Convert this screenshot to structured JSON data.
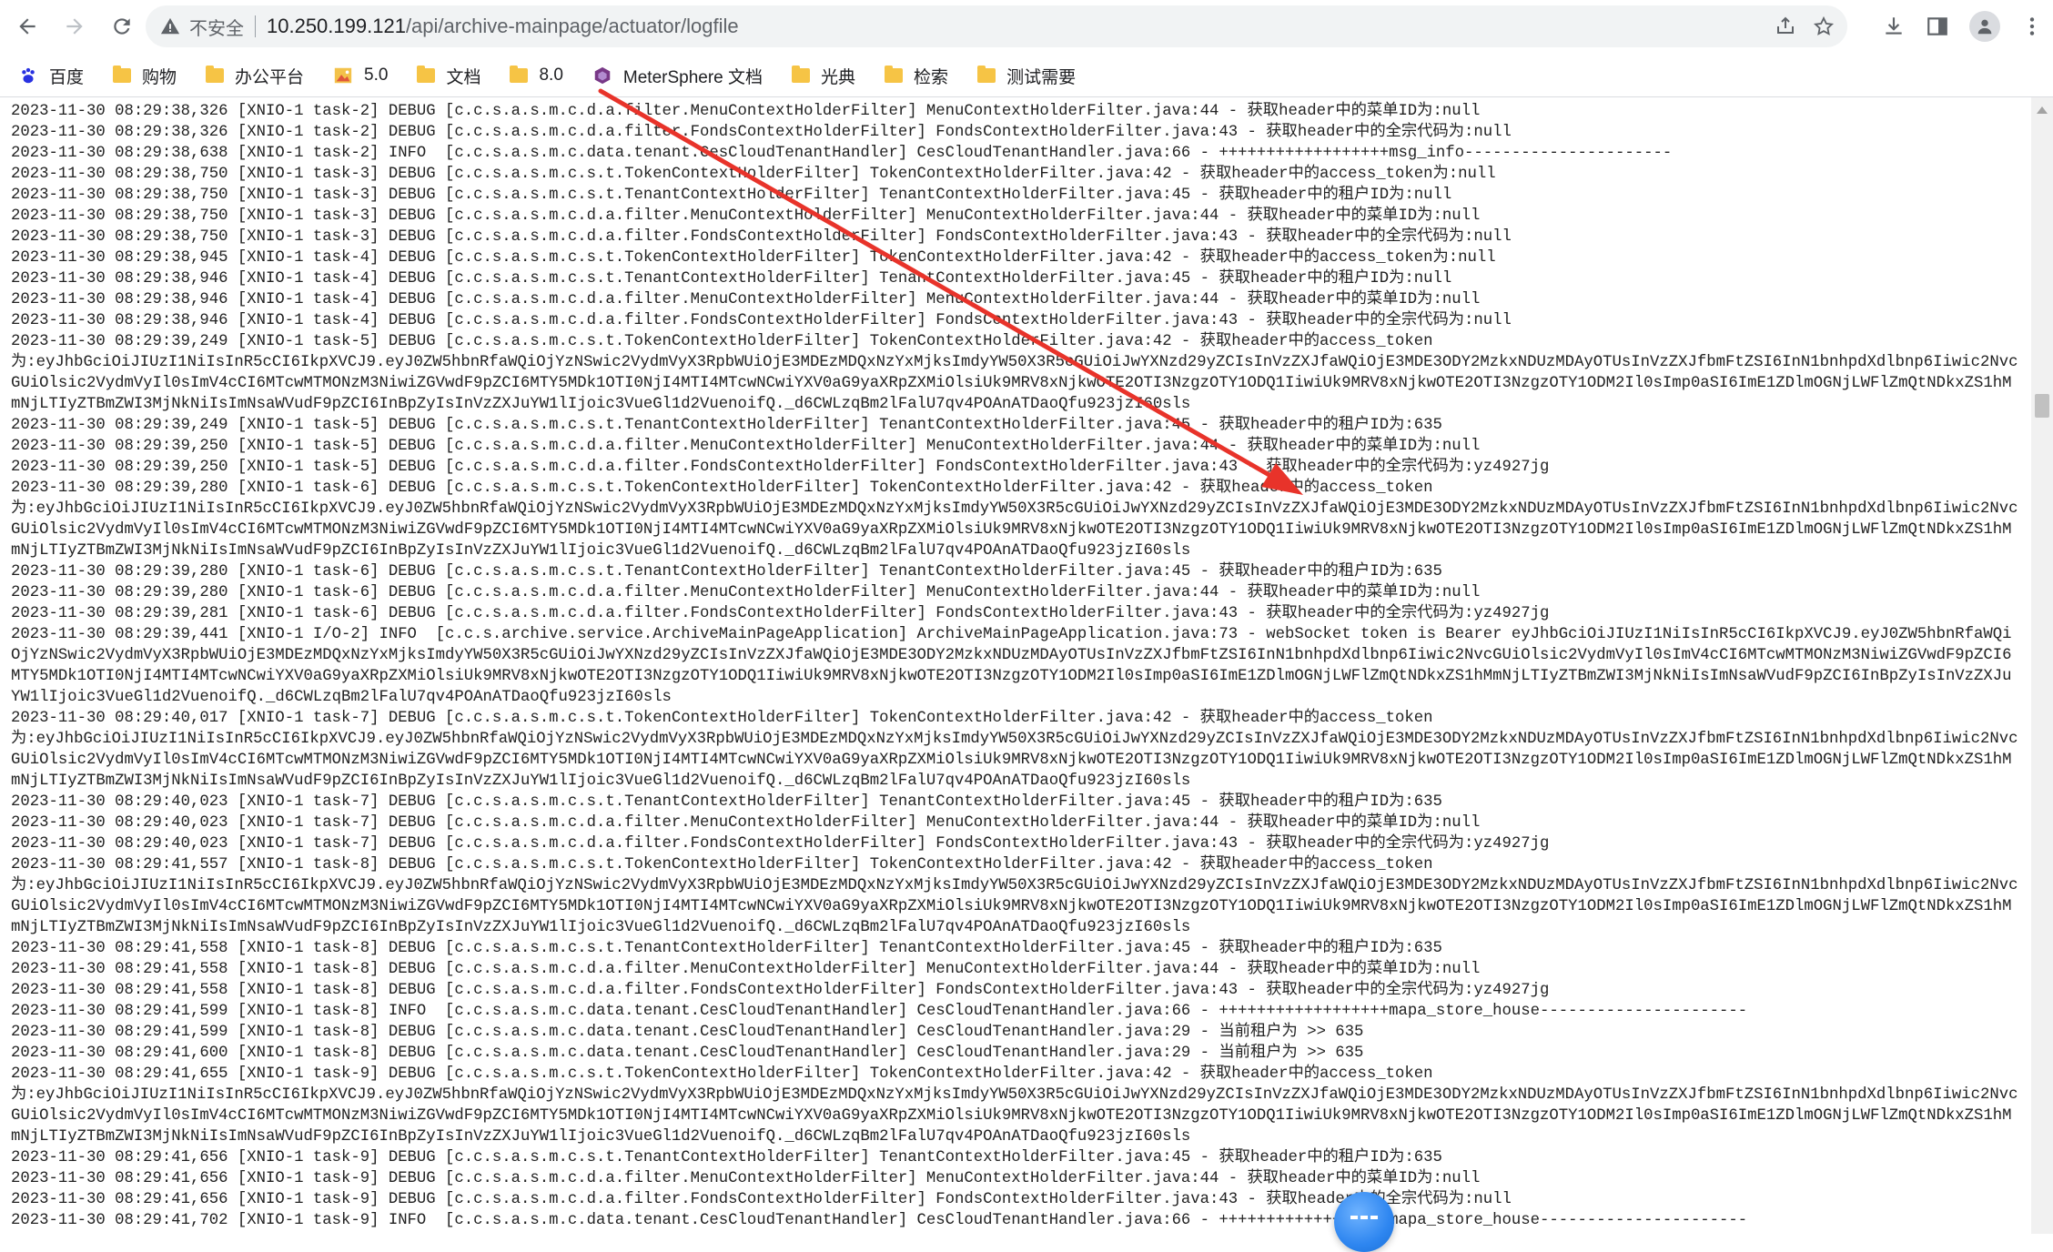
{
  "browser": {
    "insecure_label": "不安全",
    "url_host": "10.250.199.121",
    "url_path": "/api/archive-mainpage/actuator/logfile"
  },
  "bookmarks": [
    {
      "label": "百度",
      "icon": "baidu-paw-icon"
    },
    {
      "label": "购物",
      "icon": "folder-icon"
    },
    {
      "label": "办公平台",
      "icon": "folder-icon"
    },
    {
      "label": "5.0",
      "icon": "image-bookmark-icon"
    },
    {
      "label": "文档",
      "icon": "folder-icon"
    },
    {
      "label": "8.0",
      "icon": "folder-icon"
    },
    {
      "label": "MeterSphere 文档",
      "icon": "metersphere-icon"
    },
    {
      "label": "光典",
      "icon": "folder-icon"
    },
    {
      "label": "检索",
      "icon": "folder-icon"
    },
    {
      "label": "测试需要",
      "icon": "folder-icon"
    }
  ],
  "colors": {
    "arrow": "#e8332a",
    "folder": "#f6c445",
    "float_ball": "#2e86f0"
  },
  "log_lines": [
    "2023-11-30 08:29:38,326 [XNIO-1 task-2] DEBUG [c.c.s.a.s.m.c.d.a.filter.MenuContextHolderFilter] MenuContextHolderFilter.java:44 - 获取header中的菜单ID为:null",
    "2023-11-30 08:29:38,326 [XNIO-1 task-2] DEBUG [c.c.s.a.s.m.c.d.a.filter.FondsContextHolderFilter] FondsContextHolderFilter.java:43 - 获取header中的全宗代码为:null",
    "2023-11-30 08:29:38,638 [XNIO-1 task-2] INFO  [c.c.s.a.s.m.c.data.tenant.CesCloudTenantHandler] CesCloudTenantHandler.java:66 - ++++++++++++++++++msg_info----------------------",
    "2023-11-30 08:29:38,750 [XNIO-1 task-3] DEBUG [c.c.s.a.s.m.c.s.t.TokenContextHolderFilter] TokenContextHolderFilter.java:42 - 获取header中的access_token为:null",
    "2023-11-30 08:29:38,750 [XNIO-1 task-3] DEBUG [c.c.s.a.s.m.c.s.t.TenantContextHolderFilter] TenantContextHolderFilter.java:45 - 获取header中的租户ID为:null",
    "2023-11-30 08:29:38,750 [XNIO-1 task-3] DEBUG [c.c.s.a.s.m.c.d.a.filter.MenuContextHolderFilter] MenuContextHolderFilter.java:44 - 获取header中的菜单ID为:null",
    "2023-11-30 08:29:38,750 [XNIO-1 task-3] DEBUG [c.c.s.a.s.m.c.d.a.filter.FondsContextHolderFilter] FondsContextHolderFilter.java:43 - 获取header中的全宗代码为:null",
    "2023-11-30 08:29:38,945 [XNIO-1 task-4] DEBUG [c.c.s.a.s.m.c.s.t.TokenContextHolderFilter] TokenContextHolderFilter.java:42 - 获取header中的access_token为:null",
    "2023-11-30 08:29:38,946 [XNIO-1 task-4] DEBUG [c.c.s.a.s.m.c.s.t.TenantContextHolderFilter] TenantContextHolderFilter.java:45 - 获取header中的租户ID为:null",
    "2023-11-30 08:29:38,946 [XNIO-1 task-4] DEBUG [c.c.s.a.s.m.c.d.a.filter.MenuContextHolderFilter] MenuContextHolderFilter.java:44 - 获取header中的菜单ID为:null",
    "2023-11-30 08:29:38,946 [XNIO-1 task-4] DEBUG [c.c.s.a.s.m.c.d.a.filter.FondsContextHolderFilter] FondsContextHolderFilter.java:43 - 获取header中的全宗代码为:null",
    "2023-11-30 08:29:39,249 [XNIO-1 task-5] DEBUG [c.c.s.a.s.m.c.s.t.TokenContextHolderFilter] TokenContextHolderFilter.java:42 - 获取header中的access_token",
    "为:eyJhbGciOiJIUzI1NiIsInR5cCI6IkpXVCJ9.eyJ0ZW5hbnRfaWQiOjYzNSwic2VydmVyX3RpbWUiOjE3MDEzMDQxNzYxMjksImdyYW50X3R5cGUiOiJwYXNzd29yZCIsInVzZXJfaWQiOjE3MDE3ODY2MzkxNDUzMDAyOTUsInVzZXJfbmFtZSI6InN1bnhpdXdlbnp6Iiwic2NvcGUiOlsic2VydmVyIl0sImV4cCI6MTcwMTMONzM3NiwiZGVwdF9pZCI6MTY5MDk1OTI0NjI4MTI4MTcwNCwiYXV0aG9yaXRpZXMiOlsiUk9MRV8xNjkwOTE2OTI3NzgzOTY1ODQ1IiwiUk9MRV8xNjkwOTE2OTI3NzgzOTY1ODM2Il0sImp0aSI6ImE1ZDlmOGNjLWFlZmQtNDkxZS1hMmNjLTIyZTBmZWI3MjNkNiIsImNsaWVudF9pZCI6InBpZyIsInVzZXJuYW1lIjoic3VueGl1d2VuenoifQ._d6CWLzqBm2lFalU7qv4POAnATDaoQfu923jzI60sls",
    "2023-11-30 08:29:39,249 [XNIO-1 task-5] DEBUG [c.c.s.a.s.m.c.s.t.TenantContextHolderFilter] TenantContextHolderFilter.java:45 - 获取header中的租户ID为:635",
    "2023-11-30 08:29:39,250 [XNIO-1 task-5] DEBUG [c.c.s.a.s.m.c.d.a.filter.MenuContextHolderFilter] MenuContextHolderFilter.java:44 - 获取header中的菜单ID为:null",
    "2023-11-30 08:29:39,250 [XNIO-1 task-5] DEBUG [c.c.s.a.s.m.c.d.a.filter.FondsContextHolderFilter] FondsContextHolderFilter.java:43 - 获取header中的全宗代码为:yz4927jg",
    "2023-11-30 08:29:39,280 [XNIO-1 task-6] DEBUG [c.c.s.a.s.m.c.s.t.TokenContextHolderFilter] TokenContextHolderFilter.java:42 - 获取header中的access_token",
    "为:eyJhbGciOiJIUzI1NiIsInR5cCI6IkpXVCJ9.eyJ0ZW5hbnRfaWQiOjYzNSwic2VydmVyX3RpbWUiOjE3MDEzMDQxNzYxMjksImdyYW50X3R5cGUiOiJwYXNzd29yZCIsInVzZXJfaWQiOjE3MDE3ODY2MzkxNDUzMDAyOTUsInVzZXJfbmFtZSI6InN1bnhpdXdlbnp6Iiwic2NvcGUiOlsic2VydmVyIl0sImV4cCI6MTcwMTMONzM3NiwiZGVwdF9pZCI6MTY5MDk1OTI0NjI4MTI4MTcwNCwiYXV0aG9yaXRpZXMiOlsiUk9MRV8xNjkwOTE2OTI3NzgzOTY1ODQ1IiwiUk9MRV8xNjkwOTE2OTI3NzgzOTY1ODM2Il0sImp0aSI6ImE1ZDlmOGNjLWFlZmQtNDkxZS1hMmNjLTIyZTBmZWI3MjNkNiIsImNsaWVudF9pZCI6InBpZyIsInVzZXJuYW1lIjoic3VueGl1d2VuenoifQ._d6CWLzqBm2lFalU7qv4POAnATDaoQfu923jzI60sls",
    "2023-11-30 08:29:39,280 [XNIO-1 task-6] DEBUG [c.c.s.a.s.m.c.s.t.TenantContextHolderFilter] TenantContextHolderFilter.java:45 - 获取header中的租户ID为:635",
    "2023-11-30 08:29:39,280 [XNIO-1 task-6] DEBUG [c.c.s.a.s.m.c.d.a.filter.MenuContextHolderFilter] MenuContextHolderFilter.java:44 - 获取header中的菜单ID为:null",
    "2023-11-30 08:29:39,281 [XNIO-1 task-6] DEBUG [c.c.s.a.s.m.c.d.a.filter.FondsContextHolderFilter] FondsContextHolderFilter.java:43 - 获取header中的全宗代码为:yz4927jg",
    "2023-11-30 08:29:39,441 [XNIO-1 I/O-2] INFO  [c.c.s.archive.service.ArchiveMainPageApplication] ArchiveMainPageApplication.java:73 - webSocket token is Bearer eyJhbGciOiJIUzI1NiIsInR5cCI6IkpXVCJ9.eyJ0ZW5hbnRfaWQiOjYzNSwic2VydmVyX3RpbWUiOjE3MDEzMDQxNzYxMjksImdyYW50X3R5cGUiOiJwYXNzd29yZCIsInVzZXJfaWQiOjE3MDE3ODY2MzkxNDUzMDAyOTUsInVzZXJfbmFtZSI6InN1bnhpdXdlbnp6Iiwic2NvcGUiOlsic2VydmVyIl0sImV4cCI6MTcwMTMONzM3NiwiZGVwdF9pZCI6MTY5MDk1OTI0NjI4MTI4MTcwNCwiYXV0aG9yaXRpZXMiOlsiUk9MRV8xNjkwOTE2OTI3NzgzOTY1ODQ1IiwiUk9MRV8xNjkwOTE2OTI3NzgzOTY1ODM2Il0sImp0aSI6ImE1ZDlmOGNjLWFlZmQtNDkxZS1hMmNjLTIyZTBmZWI3MjNkNiIsImNsaWVudF9pZCI6InBpZyIsInVzZXJuYW1lIjoic3VueGl1d2VuenoifQ._d6CWLzqBm2lFalU7qv4POAnATDaoQfu923jzI60sls",
    "2023-11-30 08:29:40,017 [XNIO-1 task-7] DEBUG [c.c.s.a.s.m.c.s.t.TokenContextHolderFilter] TokenContextHolderFilter.java:42 - 获取header中的access_token",
    "为:eyJhbGciOiJIUzI1NiIsInR5cCI6IkpXVCJ9.eyJ0ZW5hbnRfaWQiOjYzNSwic2VydmVyX3RpbWUiOjE3MDEzMDQxNzYxMjksImdyYW50X3R5cGUiOiJwYXNzd29yZCIsInVzZXJfaWQiOjE3MDE3ODY2MzkxNDUzMDAyOTUsInVzZXJfbmFtZSI6InN1bnhpdXdlbnp6Iiwic2NvcGUiOlsic2VydmVyIl0sImV4cCI6MTcwMTMONzM3NiwiZGVwdF9pZCI6MTY5MDk1OTI0NjI4MTI4MTcwNCwiYXV0aG9yaXRpZXMiOlsiUk9MRV8xNjkwOTE2OTI3NzgzOTY1ODQ1IiwiUk9MRV8xNjkwOTE2OTI3NzgzOTY1ODM2Il0sImp0aSI6ImE1ZDlmOGNjLWFlZmQtNDkxZS1hMmNjLTIyZTBmZWI3MjNkNiIsImNsaWVudF9pZCI6InBpZyIsInVzZXJuYW1lIjoic3VueGl1d2VuenoifQ._d6CWLzqBm2lFalU7qv4POAnATDaoQfu923jzI60sls",
    "2023-11-30 08:29:40,023 [XNIO-1 task-7] DEBUG [c.c.s.a.s.m.c.s.t.TenantContextHolderFilter] TenantContextHolderFilter.java:45 - 获取header中的租户ID为:635",
    "2023-11-30 08:29:40,023 [XNIO-1 task-7] DEBUG [c.c.s.a.s.m.c.d.a.filter.MenuContextHolderFilter] MenuContextHolderFilter.java:44 - 获取header中的菜单ID为:null",
    "2023-11-30 08:29:40,023 [XNIO-1 task-7] DEBUG [c.c.s.a.s.m.c.d.a.filter.FondsContextHolderFilter] FondsContextHolderFilter.java:43 - 获取header中的全宗代码为:yz4927jg",
    "2023-11-30 08:29:41,557 [XNIO-1 task-8] DEBUG [c.c.s.a.s.m.c.s.t.TokenContextHolderFilter] TokenContextHolderFilter.java:42 - 获取header中的access_token",
    "为:eyJhbGciOiJIUzI1NiIsInR5cCI6IkpXVCJ9.eyJ0ZW5hbnRfaWQiOjYzNSwic2VydmVyX3RpbWUiOjE3MDEzMDQxNzYxMjksImdyYW50X3R5cGUiOiJwYXNzd29yZCIsInVzZXJfaWQiOjE3MDE3ODY2MzkxNDUzMDAyOTUsInVzZXJfbmFtZSI6InN1bnhpdXdlbnp6Iiwic2NvcGUiOlsic2VydmVyIl0sImV4cCI6MTcwMTMONzM3NiwiZGVwdF9pZCI6MTY5MDk1OTI0NjI4MTI4MTcwNCwiYXV0aG9yaXRpZXMiOlsiUk9MRV8xNjkwOTE2OTI3NzgzOTY1ODQ1IiwiUk9MRV8xNjkwOTE2OTI3NzgzOTY1ODM2Il0sImp0aSI6ImE1ZDlmOGNjLWFlZmQtNDkxZS1hMmNjLTIyZTBmZWI3MjNkNiIsImNsaWVudF9pZCI6InBpZyIsInVzZXJuYW1lIjoic3VueGl1d2VuenoifQ._d6CWLzqBm2lFalU7qv4POAnATDaoQfu923jzI60sls",
    "2023-11-30 08:29:41,558 [XNIO-1 task-8] DEBUG [c.c.s.a.s.m.c.s.t.TenantContextHolderFilter] TenantContextHolderFilter.java:45 - 获取header中的租户ID为:635",
    "2023-11-30 08:29:41,558 [XNIO-1 task-8] DEBUG [c.c.s.a.s.m.c.d.a.filter.MenuContextHolderFilter] MenuContextHolderFilter.java:44 - 获取header中的菜单ID为:null",
    "2023-11-30 08:29:41,558 [XNIO-1 task-8] DEBUG [c.c.s.a.s.m.c.d.a.filter.FondsContextHolderFilter] FondsContextHolderFilter.java:43 - 获取header中的全宗代码为:yz4927jg",
    "2023-11-30 08:29:41,599 [XNIO-1 task-8] INFO  [c.c.s.a.s.m.c.data.tenant.CesCloudTenantHandler] CesCloudTenantHandler.java:66 - ++++++++++++++++++mapa_store_house----------------------",
    "2023-11-30 08:29:41,599 [XNIO-1 task-8] DEBUG [c.c.s.a.s.m.c.data.tenant.CesCloudTenantHandler] CesCloudTenantHandler.java:29 - 当前租户为 >> 635",
    "2023-11-30 08:29:41,600 [XNIO-1 task-8] DEBUG [c.c.s.a.s.m.c.data.tenant.CesCloudTenantHandler] CesCloudTenantHandler.java:29 - 当前租户为 >> 635",
    "2023-11-30 08:29:41,655 [XNIO-1 task-9] DEBUG [c.c.s.a.s.m.c.s.t.TokenContextHolderFilter] TokenContextHolderFilter.java:42 - 获取header中的access_token",
    "为:eyJhbGciOiJIUzI1NiIsInR5cCI6IkpXVCJ9.eyJ0ZW5hbnRfaWQiOjYzNSwic2VydmVyX3RpbWUiOjE3MDEzMDQxNzYxMjksImdyYW50X3R5cGUiOiJwYXNzd29yZCIsInVzZXJfaWQiOjE3MDE3ODY2MzkxNDUzMDAyOTUsInVzZXJfbmFtZSI6InN1bnhpdXdlbnp6Iiwic2NvcGUiOlsic2VydmVyIl0sImV4cCI6MTcwMTMONzM3NiwiZGVwdF9pZCI6MTY5MDk1OTI0NjI4MTI4MTcwNCwiYXV0aG9yaXRpZXMiOlsiUk9MRV8xNjkwOTE2OTI3NzgzOTY1ODQ1IiwiUk9MRV8xNjkwOTE2OTI3NzgzOTY1ODM2Il0sImp0aSI6ImE1ZDlmOGNjLWFlZmQtNDkxZS1hMmNjLTIyZTBmZWI3MjNkNiIsImNsaWVudF9pZCI6InBpZyIsInVzZXJuYW1lIjoic3VueGl1d2VuenoifQ._d6CWLzqBm2lFalU7qv4POAnATDaoQfu923jzI60sls",
    "2023-11-30 08:29:41,656 [XNIO-1 task-9] DEBUG [c.c.s.a.s.m.c.s.t.TenantContextHolderFilter] TenantContextHolderFilter.java:45 - 获取header中的租户ID为:635",
    "2023-11-30 08:29:41,656 [XNIO-1 task-9] DEBUG [c.c.s.a.s.m.c.d.a.filter.MenuContextHolderFilter] MenuContextHolderFilter.java:44 - 获取header中的菜单ID为:null",
    "2023-11-30 08:29:41,656 [XNIO-1 task-9] DEBUG [c.c.s.a.s.m.c.d.a.filter.FondsContextHolderFilter] FondsContextHolderFilter.java:43 - 获取header中的全宗代码为:null",
    "2023-11-30 08:29:41,702 [XNIO-1 task-9] INFO  [c.c.s.a.s.m.c.data.tenant.CesCloudTenantHandler] CesCloudTenantHandler.java:66 - ++++++++++++++++++mapa_store_house----------------------"
  ]
}
